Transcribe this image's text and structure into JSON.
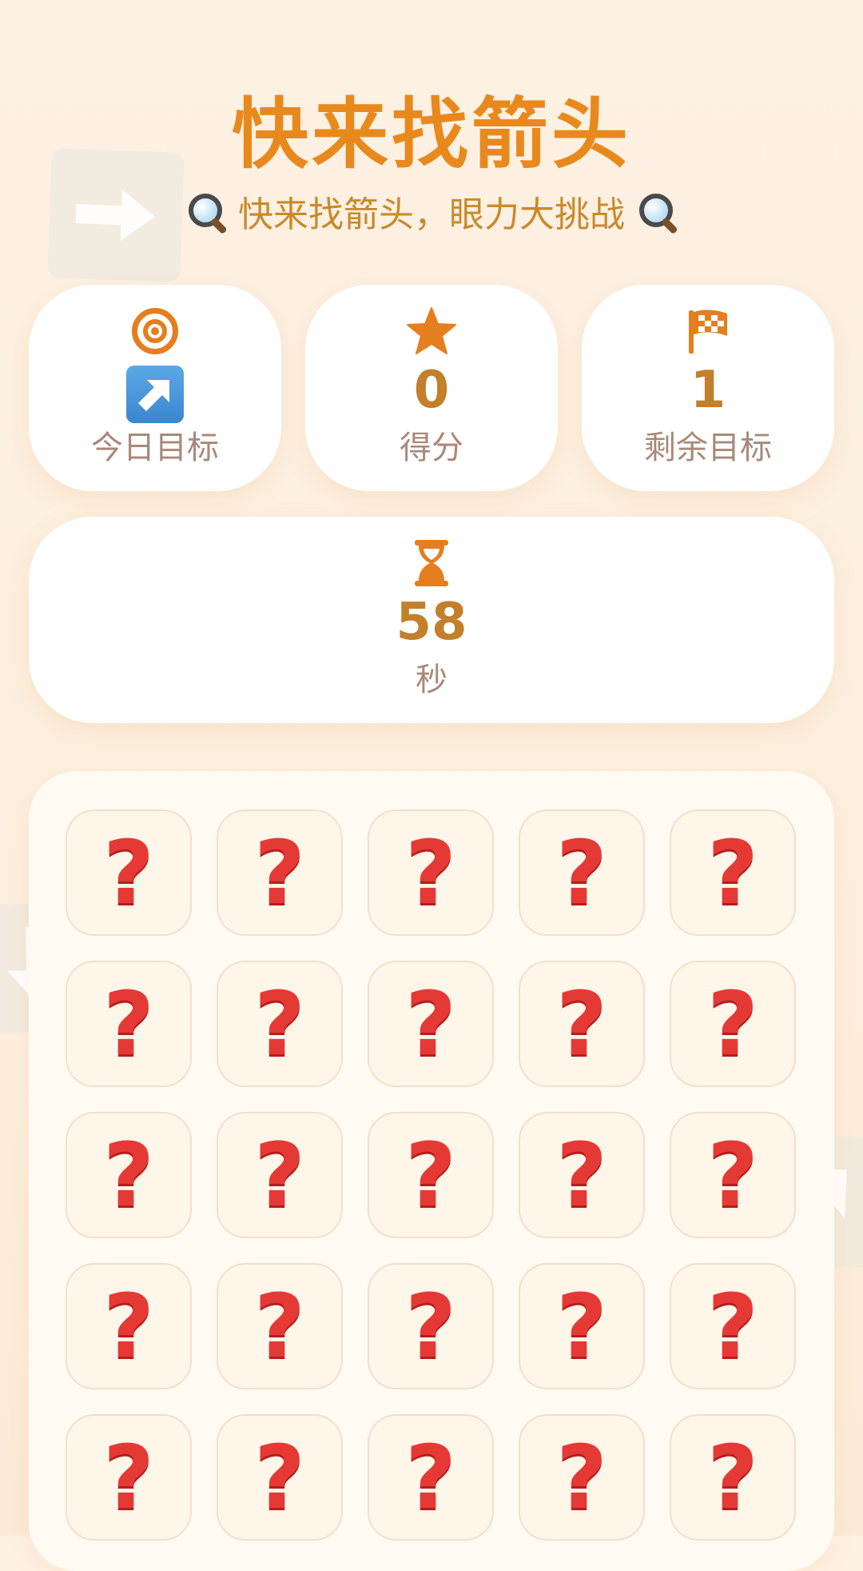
{
  "header": {
    "title": "快来找箭头",
    "subtitle": "快来找箭头，眼力大挑战",
    "subtitle_icon": "magnifying-glass-icon"
  },
  "stats": {
    "target": {
      "icon": "target-icon",
      "value_icon": "up-right-arrow-icon",
      "label": "今日目标"
    },
    "score": {
      "icon": "star-icon",
      "value": "0",
      "label": "得分"
    },
    "remaining": {
      "icon": "checkered-flag-icon",
      "value": "1",
      "label": "剩余目标"
    },
    "timer": {
      "icon": "hourglass-icon",
      "value": "58",
      "label": "秒"
    }
  },
  "grid": {
    "rows": 5,
    "columns": 5,
    "cell_symbol": "?",
    "cells": [
      "?",
      "?",
      "?",
      "?",
      "?",
      "?",
      "?",
      "?",
      "?",
      "?",
      "?",
      "?",
      "?",
      "?",
      "?",
      "?",
      "?",
      "?",
      "?",
      "?",
      "?",
      "?",
      "?",
      "?",
      "?"
    ]
  },
  "colors": {
    "accent": "#e8891e",
    "value_text": "#c47f2a",
    "label_text": "#a8897a",
    "question_mark": "#e53935",
    "background": "#fdf1e3"
  }
}
